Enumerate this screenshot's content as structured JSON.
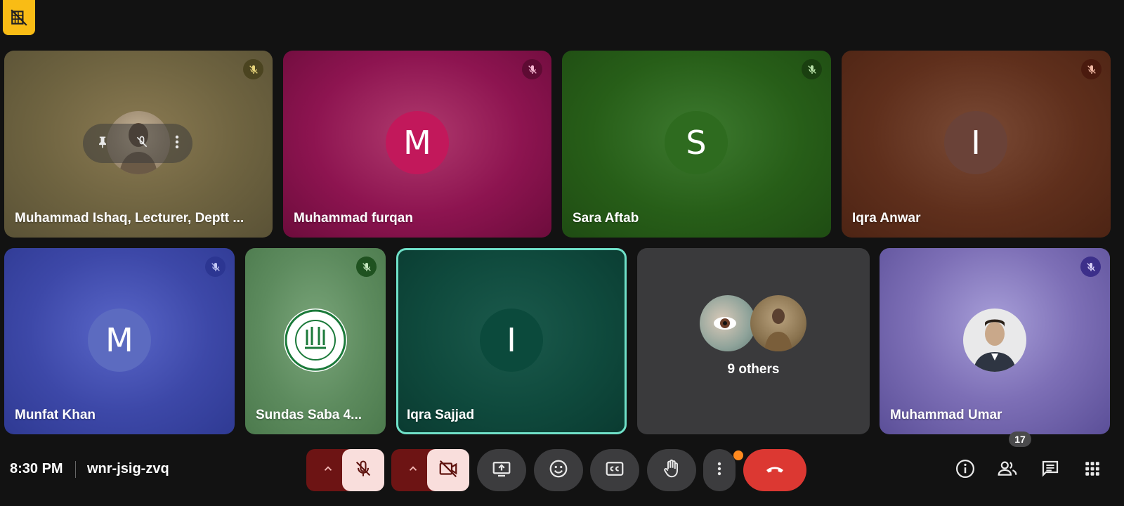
{
  "participants": [
    {
      "name": "Muhammad Ishaq, Lecturer, Deptt ..."
    },
    {
      "name": "Muhammad furqan",
      "initial": "M"
    },
    {
      "name": "Sara Aftab",
      "initial": "S"
    },
    {
      "name": "Iqra Anwar",
      "initial": "I"
    },
    {
      "name": "Munfat Khan",
      "initial": "M"
    },
    {
      "name": "Sundas Saba 4..."
    },
    {
      "name": "Iqra Sajjad",
      "initial": "I"
    },
    {
      "name": "Muhammad Umar"
    }
  ],
  "others_label": "9 others",
  "bottom_bar": {
    "time": "8:30 PM",
    "meeting_code": "wnr-jsig-zvq",
    "people_count": "17"
  },
  "colors": {
    "end_call": "#dc3832",
    "active_speaker_border": "#6fe0c8",
    "badge": "#f9bc15"
  }
}
